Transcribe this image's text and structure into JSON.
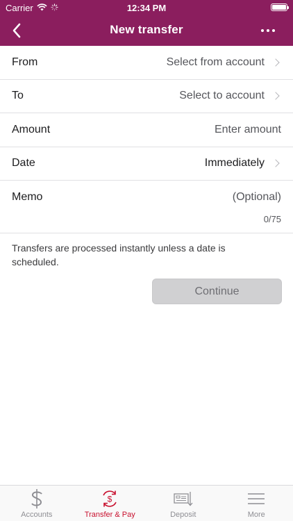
{
  "status_bar": {
    "carrier": "Carrier",
    "time": "12:34 PM",
    "battery_level": 1.0
  },
  "nav": {
    "title": "New transfer",
    "back_icon": "chevron-left-icon",
    "more_icon": "more-dots-icon"
  },
  "form": {
    "from": {
      "label": "From",
      "value": "Select from account"
    },
    "to": {
      "label": "To",
      "value": "Select to account"
    },
    "amount": {
      "label": "Amount",
      "placeholder": "Enter amount"
    },
    "date": {
      "label": "Date",
      "value": "Immediately"
    },
    "memo": {
      "label": "Memo",
      "placeholder": "(Optional)",
      "counter": "0/75"
    }
  },
  "info_text": "Transfers are processed instantly unless a date is scheduled.",
  "continue_label": "Continue",
  "tabs": [
    {
      "label": "Accounts",
      "icon": "dollar-icon",
      "active": false
    },
    {
      "label": "Transfer & Pay",
      "icon": "transfer-cycle-icon",
      "active": true
    },
    {
      "label": "Deposit",
      "icon": "check-deposit-icon",
      "active": false
    },
    {
      "label": "More",
      "icon": "hamburger-menu-icon",
      "active": false
    }
  ],
  "colors": {
    "brand": "#8b1e5e",
    "active_tab": "#c8102e",
    "button_disabled": "#d0d0d2"
  }
}
